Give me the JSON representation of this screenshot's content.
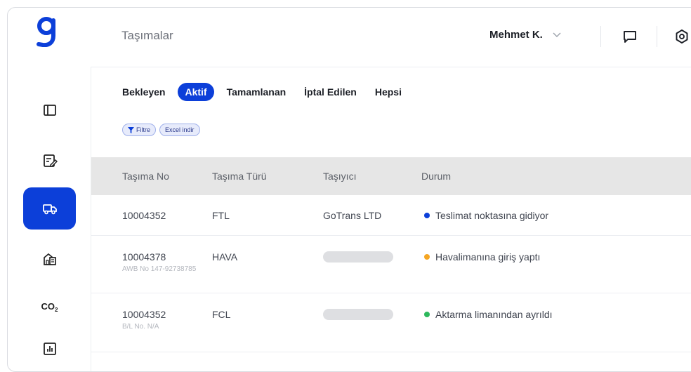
{
  "header": {
    "title": "Taşımalar",
    "user_name": "Mehmet K."
  },
  "nav": {
    "items": [
      {
        "icon": "panel-icon"
      },
      {
        "icon": "edit-list-icon"
      },
      {
        "icon": "truck-icon",
        "active": true
      },
      {
        "icon": "warehouse-icon"
      },
      {
        "icon": "co2-icon",
        "text": "CO",
        "sub": "2"
      },
      {
        "icon": "bar-chart-icon"
      }
    ]
  },
  "tabs": [
    "Bekleyen",
    "Aktif",
    "Tamamlanan",
    "İptal Edilen",
    "Hepsi"
  ],
  "active_tab": "Aktif",
  "chips": {
    "filter": "Filtre",
    "excel": "Excel indir"
  },
  "table": {
    "columns": [
      "Taşıma No",
      "Taşıma Türü",
      "Taşıyıcı",
      "Durum"
    ],
    "rows": [
      {
        "no": "10004352",
        "type": "FTL",
        "carrier": "GoTrans LTD",
        "sub": "",
        "status": "Teslimat noktasına gidiyor",
        "status_color": "#0c3fd9"
      },
      {
        "no": "10004378",
        "type": "HAVA",
        "carrier": "",
        "sub": "AWB No 147-92738785",
        "status": "Havalimanına giriş yaptı",
        "status_color": "#f5a623"
      },
      {
        "no": "10004352",
        "type": "FCL",
        "carrier": "",
        "sub": "B/L No. N/A",
        "status": "Aktarma limanından ayrıldı",
        "status_color": "#2db85c"
      }
    ]
  },
  "colors": {
    "brand": "#0c3fd9",
    "table_header": "#e6e6e6"
  }
}
